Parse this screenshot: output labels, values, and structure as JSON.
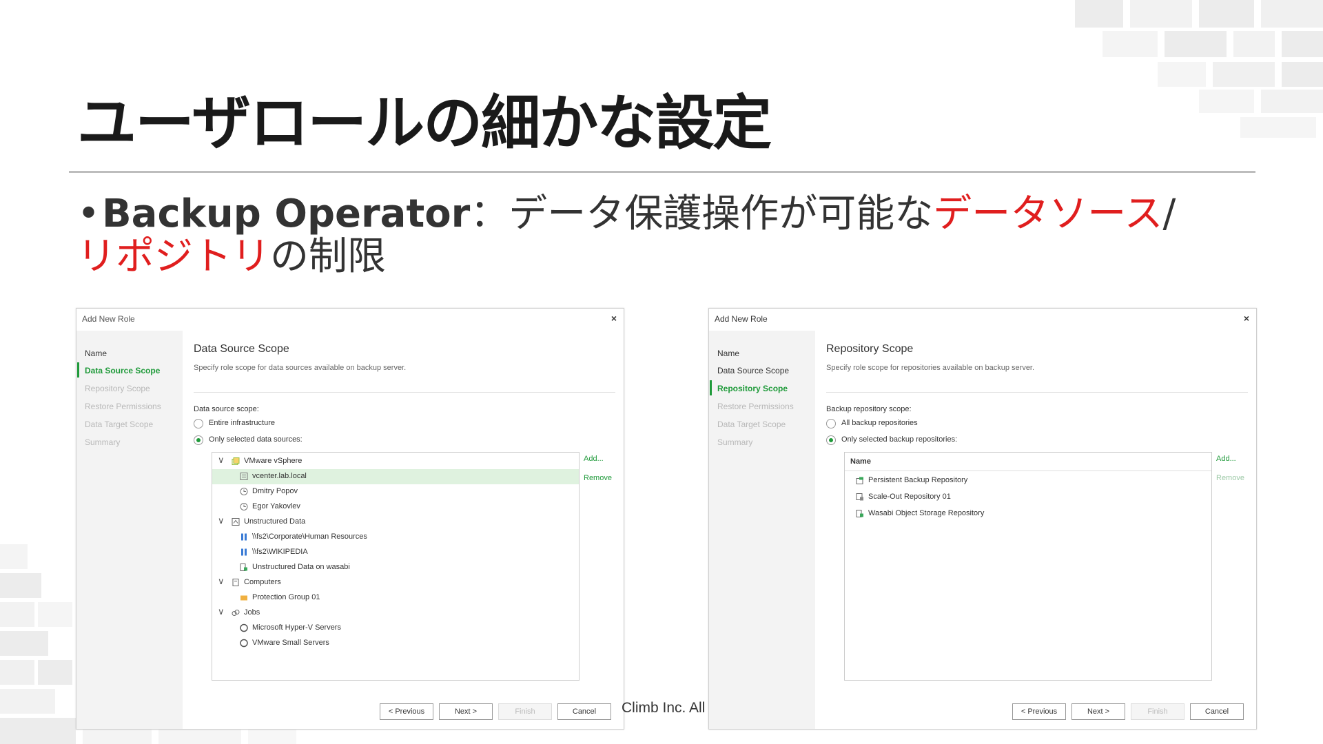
{
  "slide": {
    "title": "ユーザロールの細かな設定",
    "bullet_role": "Backup Operator",
    "bullet_sep": "：データ保護操作が可能な",
    "bullet_red1": "データソース",
    "bullet_slash": "/",
    "bullet_red2": "リポジトリ",
    "bullet_tail": "の制限",
    "footer_text": "Climb Inc. All"
  },
  "colors": {
    "accent_green": "#1f9a3a",
    "highlight_red": "#e01e1e"
  },
  "dialog_left": {
    "window_title": "Add New Role",
    "close_icon": "×",
    "steps": [
      "Name",
      "Data Source Scope",
      "Repository Scope",
      "Restore Permissions",
      "Data Target Scope",
      "Summary"
    ],
    "heading": "Data Source Scope",
    "subtitle": "Specify role scope for data sources available on backup server.",
    "scope_label": "Data source scope:",
    "options": [
      "Entire infrastructure",
      "Only selected data sources:"
    ],
    "add_label": "Add...",
    "remove_label": "Remove",
    "tree": [
      {
        "label": "VMware vSphere",
        "icon": "vsphere-icon"
      },
      {
        "label": "vcenter.lab.local",
        "icon": "vcenter-icon"
      },
      {
        "label": "Dmitry Popov",
        "icon": "vm-icon"
      },
      {
        "label": "Egor Yakovlev",
        "icon": "vm-icon"
      },
      {
        "label": "Unstructured Data",
        "icon": "unstructured-icon"
      },
      {
        "label": "\\\\fs2\\Corporate\\Human Resources",
        "icon": "share-icon"
      },
      {
        "label": "\\\\fs2\\WIKIPEDIA",
        "icon": "share-icon"
      },
      {
        "label": "Unstructured Data on wasabi",
        "icon": "object-storage-icon"
      },
      {
        "label": "Computers",
        "icon": "computer-icon"
      },
      {
        "label": "Protection Group 01",
        "icon": "folder-icon"
      },
      {
        "label": "Jobs",
        "icon": "jobs-icon"
      },
      {
        "label": "Microsoft Hyper-V Servers",
        "icon": "job-icon"
      },
      {
        "label": "VMware Small Servers",
        "icon": "job-icon"
      }
    ],
    "buttons": [
      "< Previous",
      "Next >",
      "Finish",
      "Cancel"
    ]
  },
  "dialog_right": {
    "window_title": "Add New Role",
    "close_icon": "×",
    "steps": [
      "Name",
      "Data Source Scope",
      "Repository Scope",
      "Restore Permissions",
      "Data Target Scope",
      "Summary"
    ],
    "heading": "Repository Scope",
    "subtitle": "Specify role scope for repositories available on backup server.",
    "scope_label": "Backup repository scope:",
    "options": [
      "All backup repositories",
      "Only selected backup repositories:"
    ],
    "add_label": "Add...",
    "remove_label": "Remove",
    "column_header": "Name",
    "repos": [
      {
        "label": "Persistent Backup Repository",
        "icon": "repository-icon"
      },
      {
        "label": "Scale-Out Repository 01",
        "icon": "scaleout-repository-icon"
      },
      {
        "label": "Wasabi Object Storage Repository",
        "icon": "object-storage-icon"
      }
    ],
    "buttons": [
      "< Previous",
      "Next >",
      "Finish",
      "Cancel"
    ]
  }
}
